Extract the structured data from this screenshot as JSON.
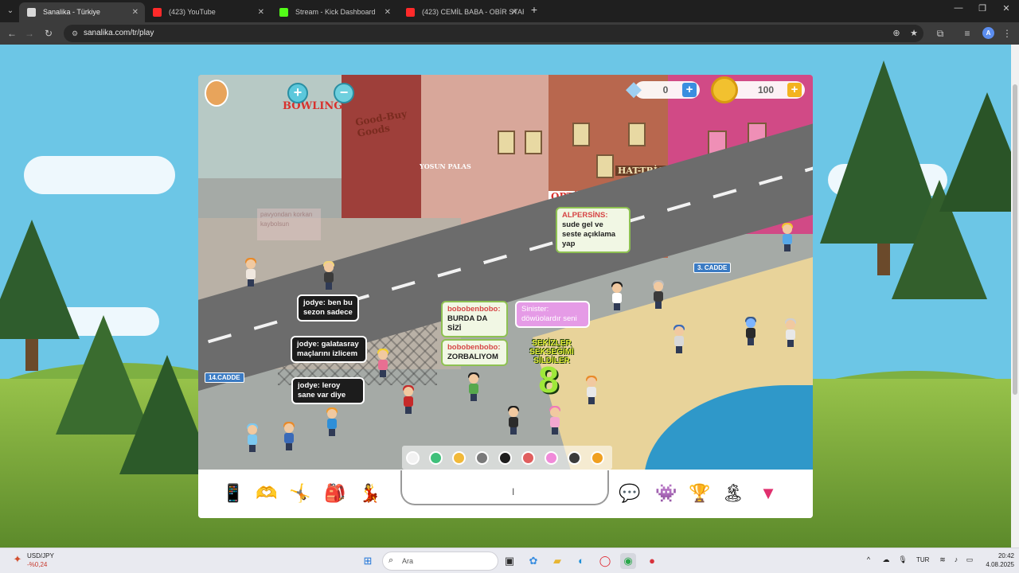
{
  "browser": {
    "tabs": [
      {
        "title": "Sanalika - Türkiye",
        "active": true,
        "favicon_color": "#d8d8d8"
      },
      {
        "title": "(423) YouTube",
        "active": false,
        "favicon_color": "#ff2a2a"
      },
      {
        "title": "Stream - Kick Dashboard",
        "active": false,
        "favicon_color": "#53fc18"
      },
      {
        "title": "(423) CEMİL BABA - OBİR STAR",
        "active": false,
        "favicon_color": "#ff2a2a"
      }
    ],
    "url": "sanalika.com/tr/play",
    "profile_initial": "A"
  },
  "game": {
    "gems": "0",
    "coins": "100",
    "add_label": "+",
    "zoom_in": "+",
    "zoom_out": "−",
    "signs": {
      "bowling": "BOWLING",
      "goodbuy": "Good-Buy Goods",
      "optika": "OPTİKA",
      "hattrick": "HAT-TRİCK",
      "yosun": "YOSUN PALAS",
      "street14": "14.CADDE",
      "street3": "3. CADDE"
    },
    "stale_sign_text": "pavyondan korkan kaybolsun",
    "bubbles": [
      {
        "nick": "ALPERSİNS:",
        "text": "sude gel ve seste açıklama yap",
        "style": "light"
      },
      {
        "nick": "jodye:",
        "text": "ben bu sezon sadece",
        "style": "dark"
      },
      {
        "nick": "jodye:",
        "text": "galatasray maçlarını izlicem",
        "style": "dark"
      },
      {
        "nick": "jodye:",
        "text": "leroy sane var diye",
        "style": "dark"
      },
      {
        "nick": "bobobenbobo:",
        "text": "BURDA DA SİZİ",
        "style": "light"
      },
      {
        "nick": "bobobenbobo:",
        "text": "ZORBALIYOM",
        "style": "light"
      },
      {
        "nick": "Sinister:",
        "text": "döwüolardır seni",
        "style": "pink"
      }
    ],
    "overlay": {
      "text": "SEKİZLER SEKSEĞİMİ SİLDİLER",
      "number": "8"
    },
    "palette": [
      "#f2f2f2",
      "#3fc07a",
      "#f1b93a",
      "#7a7a7a",
      "#1e1e1e",
      "#e05f5f",
      "#f08ad9",
      "#3b3b3b",
      "#f0a020"
    ],
    "toolbar_left": [
      {
        "name": "phone-icon",
        "glyph": "📱"
      },
      {
        "name": "emote-icon",
        "glyph": "🫶"
      },
      {
        "name": "action-icon",
        "glyph": "🤸"
      },
      {
        "name": "inventory-bag-icon",
        "glyph": "🎒"
      },
      {
        "name": "dance-icon",
        "glyph": "💃"
      }
    ],
    "toolbar_right": [
      {
        "name": "chat-bubbles-icon",
        "glyph": "💬"
      },
      {
        "name": "pet-icon",
        "glyph": "👾"
      },
      {
        "name": "trophy-icon",
        "glyph": "🏆"
      },
      {
        "name": "island-icon",
        "glyph": "🏝"
      },
      {
        "name": "menu-toggle-icon",
        "glyph": "▼"
      }
    ]
  },
  "taskbar": {
    "ticker_name": "USD/JPY",
    "ticker_change": "-%0,24",
    "search_placeholder": "Ara",
    "language": "TUR",
    "time": "20:42",
    "date": "4.08.2025"
  },
  "colors": {
    "accent_blue": "#3a8ee0",
    "coin_add": "#f3b31f",
    "gem_add": "#3a8ee0"
  }
}
